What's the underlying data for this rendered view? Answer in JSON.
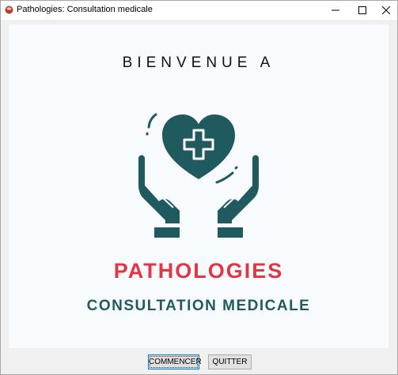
{
  "window": {
    "title": "Pathologies: Consultation medicale",
    "controls": [
      "minimize-icon",
      "maximize-icon",
      "close-icon"
    ]
  },
  "splash": {
    "welcome": "BIENVENUE A",
    "app_name": "PATHOLOGIES",
    "subtitle": "CONSULTATION MEDICALE",
    "logo_icon": "heart-hands-medical-cross-icon"
  },
  "buttons": {
    "start_label": "COMMENCER",
    "quit_label": "QUITTER"
  },
  "colors": {
    "teal": "#1f5a5e",
    "red": "#e23545",
    "panel_bg": "#f8fbfd"
  }
}
